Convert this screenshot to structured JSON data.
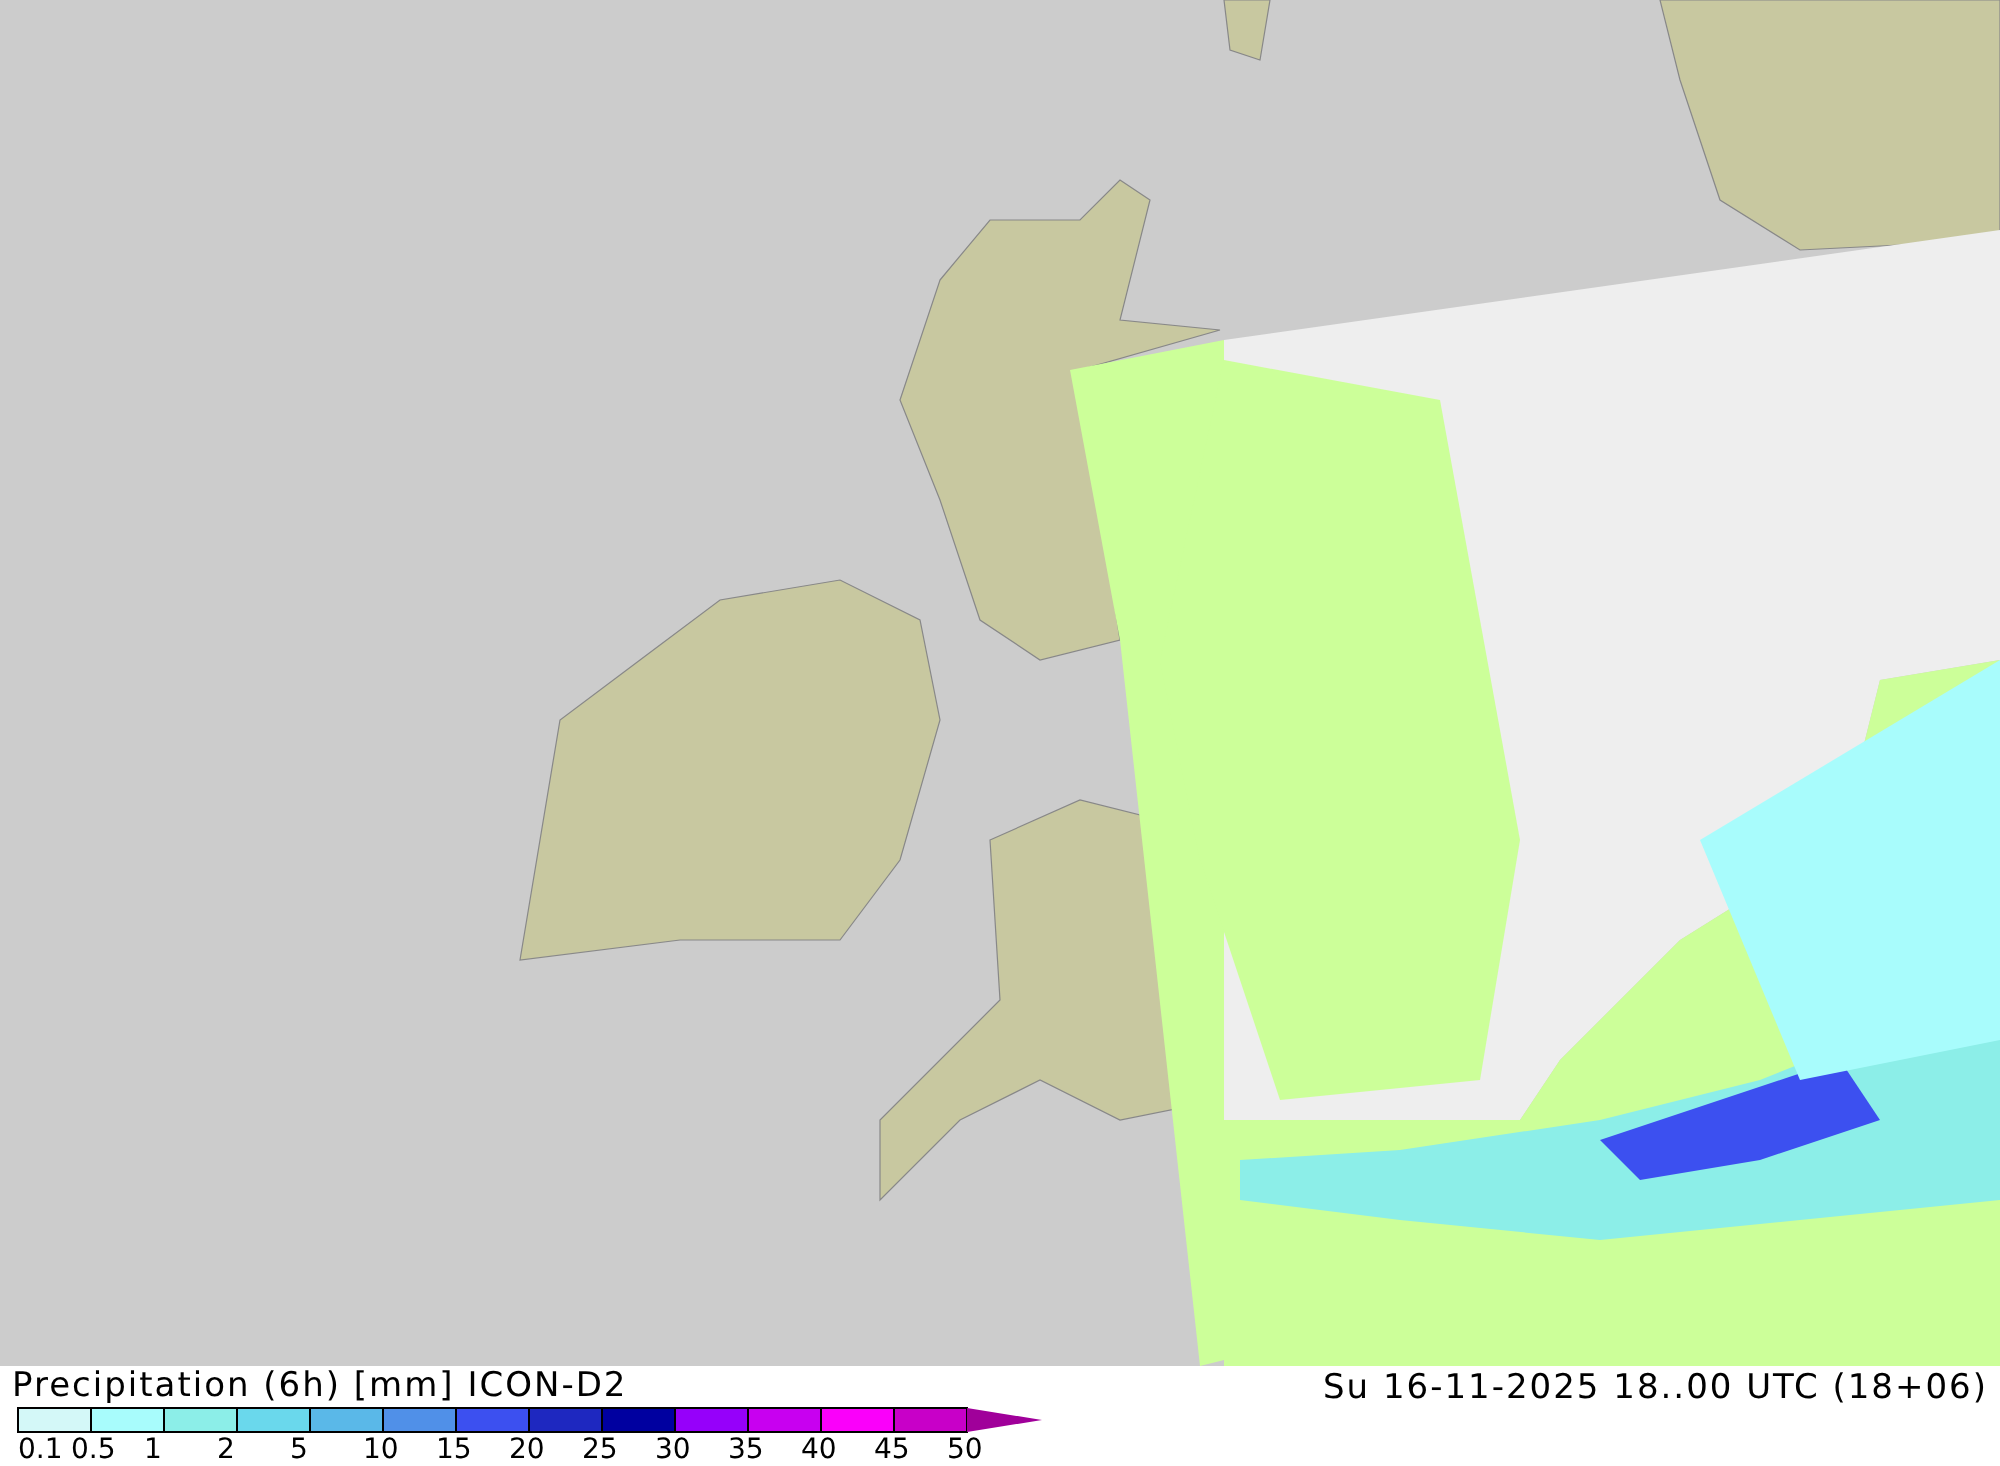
{
  "legend": {
    "title": "Precipitation (6h) [mm] ICON-D2",
    "timestamp": "Su 16-11-2025 18..00 UTC (18+06)",
    "scale": [
      {
        "color": "#d4f8f8"
      },
      {
        "color": "#a8fcfc"
      },
      {
        "color": "#8ceee8"
      },
      {
        "color": "#6ad8ec"
      },
      {
        "color": "#5ab8e8"
      },
      {
        "color": "#5090e8"
      },
      {
        "color": "#3c50f0"
      },
      {
        "color": "#1e28c0"
      },
      {
        "color": "#0000a0"
      },
      {
        "color": "#9600fa"
      },
      {
        "color": "#c800f0"
      },
      {
        "color": "#fa00fa"
      },
      {
        "color": "#c800c8"
      },
      {
        "color": "#a0009a",
        "kind": "overflow"
      }
    ],
    "ticks": [
      "0.1",
      "0.5",
      "1",
      "2",
      "5",
      "10",
      "15",
      "20",
      "25",
      "30",
      "35",
      "40",
      "45",
      "50"
    ]
  }
}
